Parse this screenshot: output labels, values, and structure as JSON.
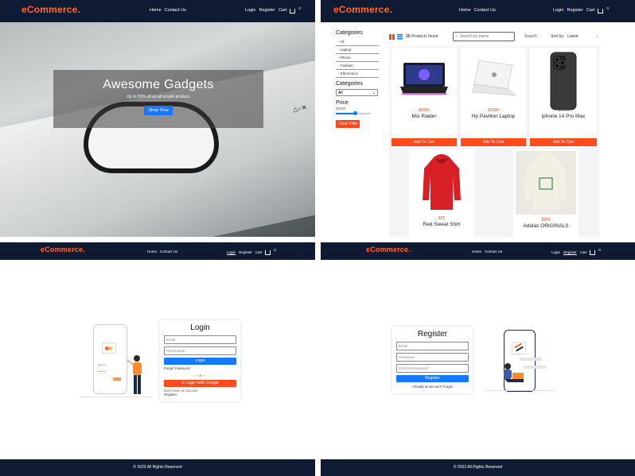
{
  "brand": "eCommerce.",
  "nav": {
    "home": "Home",
    "contact": "Contact Us",
    "login": "Login",
    "register": "Register",
    "cart": "Cart",
    "cart_count": "0"
  },
  "hero": {
    "title": "Awesome Gadgets",
    "subtitle": "Up to 50% off on all onsale producs",
    "button": "Shop Now"
  },
  "shop": {
    "categories_heading": "Categories",
    "categories": [
      "- All",
      "- Laptop",
      "- Phone",
      "- Fashion",
      "- Electronics"
    ],
    "categories_heading_2": "Categories",
    "category_select": "All",
    "price_heading": "Price",
    "price_value": "$3000",
    "price_slider_fraction": 0.55,
    "clear_filter": "Clear Filter",
    "found_count": "15",
    "found_label": "Products found",
    "search_placeholder": "Search by name",
    "search_label": "Search",
    "sort_label": "Sort by:",
    "sort_value": "Latest",
    "add_to_cart": "Add To Cart",
    "products": [
      {
        "price": "$5000",
        "name": "Msi Raider"
      },
      {
        "price": "$1500",
        "name": "Hp Pavilion Laptop"
      },
      {
        "price": "$1500",
        "name": "iphone 14 Pro Max"
      },
      {
        "price": "$32",
        "name": "Red Sweat Shirt"
      },
      {
        "price": "$300",
        "name": "Adidas ORIGINALS"
      }
    ]
  },
  "login": {
    "title": "Login",
    "email_placeholder": "Email",
    "password_placeholder": "Placeholder",
    "button": "Login",
    "forgot": "Forgot Password",
    "or": "-- or --",
    "google": "Login With Google",
    "no_account": "Don't have an account",
    "register_link": "Register"
  },
  "register": {
    "title": "Register",
    "email_placeholder": "Email",
    "password_placeholder": "Password",
    "confirm_placeholder": "Confirm Password",
    "button": "Register",
    "have_account": "Already an account ?Login"
  },
  "footer": "© 2023 All Rights Reserved",
  "colors": {
    "nav_bg": "#0f1a33",
    "brand": "#ff6a2a",
    "accent": "#ff4a1c",
    "primary": "#1677ff"
  }
}
